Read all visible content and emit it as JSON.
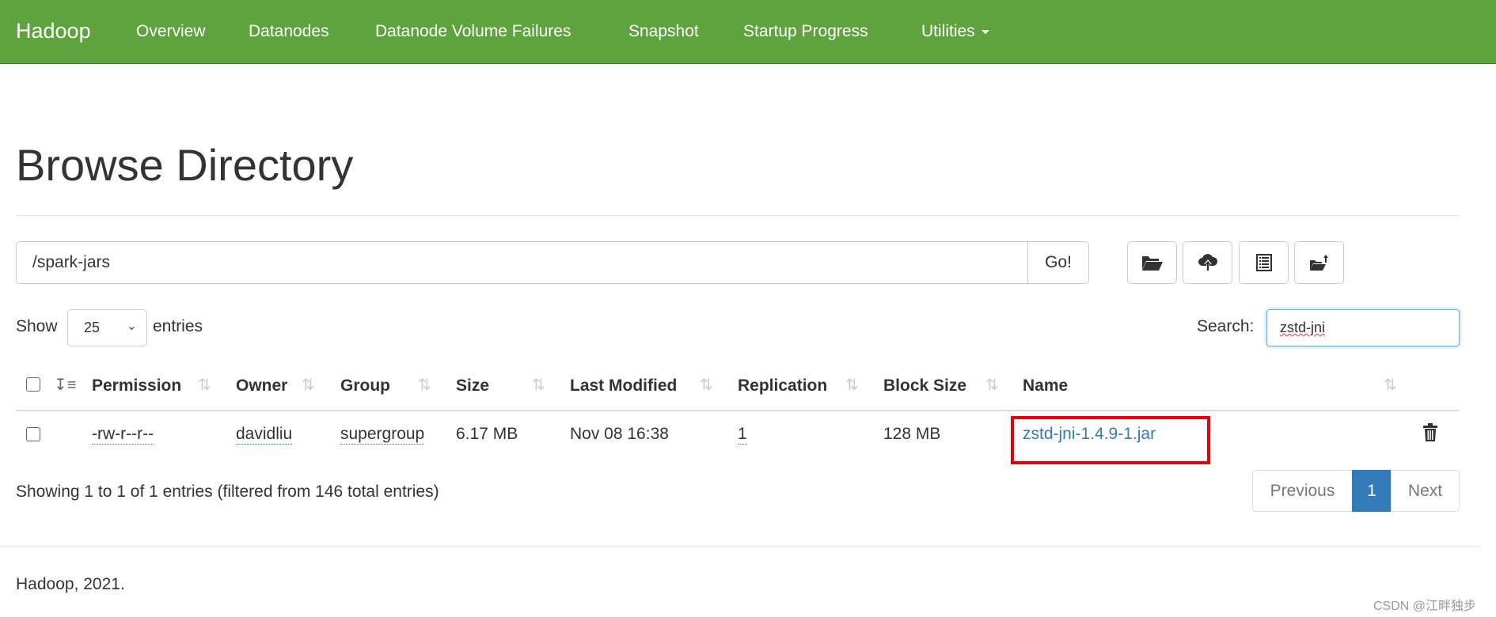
{
  "navbar": {
    "brand": "Hadoop",
    "items": [
      "Overview",
      "Datanodes",
      "Datanode Volume Failures",
      "Snapshot",
      "Startup Progress",
      "Utilities"
    ],
    "color": "#5fa33e"
  },
  "page_title": "Browse Directory",
  "path_input": {
    "value": "/spark-jars",
    "go_label": "Go!"
  },
  "toolbar_icons": [
    "folder-open-icon",
    "cloud-upload-icon",
    "list-icon",
    "folder-upload-icon"
  ],
  "length": {
    "show_label": "Show",
    "value": "25",
    "entries_label": "entries"
  },
  "search": {
    "label": "Search:",
    "value": "zstd-jni"
  },
  "table": {
    "headers": [
      "Permission",
      "Owner",
      "Group",
      "Size",
      "Last Modified",
      "Replication",
      "Block Size",
      "Name"
    ],
    "rows": [
      {
        "permission": "-rw-r--r--",
        "owner": "davidliu",
        "group": "supergroup",
        "size": "6.17 MB",
        "last_modified": "Nov 08 16:38",
        "replication": "1",
        "block_size": "128 MB",
        "name": "zstd-jni-1.4.9-1.jar"
      }
    ]
  },
  "info": "Showing 1 to 1 of 1 entries (filtered from 146 total entries)",
  "pagination": {
    "previous": "Previous",
    "current": "1",
    "next": "Next",
    "active_color": "#337ab7"
  },
  "footer": "Hadoop, 2021.",
  "watermark": "CSDN @江畔独步",
  "highlight_color": "#e8000b"
}
